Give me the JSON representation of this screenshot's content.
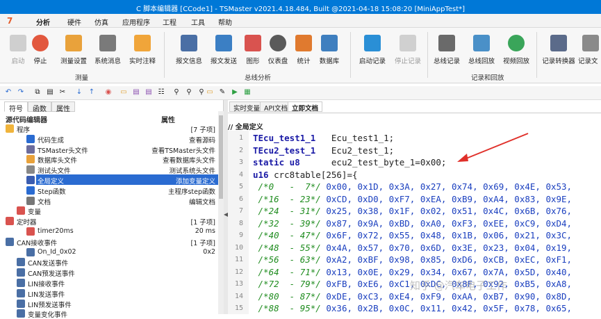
{
  "window": {
    "title": "C 脚本编辑器 [CCode1] - TSMaster v2021.4.18.484, Built @2021-04-18 15:08:20 [MiniAppTest*]"
  },
  "menu": [
    "分析",
    "硬件",
    "仿真",
    "应用程序",
    "工程",
    "工具",
    "帮助"
  ],
  "ribbon": {
    "buttons": [
      "启动",
      "停止",
      "测量设置",
      "系统消息",
      "实时注释",
      "报文信息",
      "报文发送",
      "图形",
      "仪表盘",
      "统计",
      "数据库",
      "启动记录",
      "停止记录",
      "总线记录",
      "总线回放",
      "视频回放",
      "记录转换器",
      "记录文"
    ],
    "groups": [
      "测量",
      "总线分析",
      "记录和回放"
    ],
    "colors": {
      "accent": "#0078d7",
      "start": "#8a8a8a",
      "stop": "#e2583e",
      "note": "#f0a53a",
      "play": "#2a8fd6"
    }
  },
  "left": {
    "tabs": [
      "符号",
      "函数",
      "属性"
    ],
    "headers": {
      "col1": "源代码编辑器",
      "col2": "属性"
    },
    "tree": [
      {
        "label": "程序",
        "right": "[7 子项]",
        "icon": "folder-icon"
      },
      {
        "label": "代码生成",
        "right": "查看源码",
        "icon": "c-code-icon"
      },
      {
        "label": "TSMaster头文件",
        "right": "查看TSMaster头文件",
        "icon": "header-icon"
      },
      {
        "label": "数据库头文件",
        "right": "查看数据库头文件",
        "icon": "database-icon"
      },
      {
        "label": "测试头文件",
        "right": "测试系统头文件",
        "icon": "test-icon"
      },
      {
        "label": "全局定义",
        "right": "添加变量定义",
        "icon": "global-icon"
      },
      {
        "label": "Step函数",
        "right": "主程序step函数",
        "icon": "step-icon"
      },
      {
        "label": "文档",
        "right": "编辑文档",
        "icon": "doc-icon"
      },
      {
        "label": "变量",
        "right": "",
        "icon": "variable-icon"
      },
      {
        "label": "定时器",
        "right": "[1 子项]",
        "icon": "timer-icon"
      },
      {
        "label": "timer20ms",
        "right": "20 ms",
        "icon": "clock-icon"
      },
      {
        "label": "CAN接收事件",
        "right": "[1 子项]",
        "icon": "can-rx-icon"
      },
      {
        "label": "On_Id_0x02",
        "right": "0x2",
        "icon": "event-icon"
      },
      {
        "label": "CAN发送事件",
        "right": "",
        "icon": "can-tx-icon"
      },
      {
        "label": "CAN预发送事件",
        "right": "",
        "icon": "can-pretx-icon"
      },
      {
        "label": "LIN接收事件",
        "right": "",
        "icon": "lin-rx-icon"
      },
      {
        "label": "LIN发送事件",
        "right": "",
        "icon": "lin-tx-icon"
      },
      {
        "label": "LIN预发送事件",
        "right": "",
        "icon": "lin-pretx-icon"
      },
      {
        "label": "变量变化事件",
        "right": "",
        "icon": "var-change-icon"
      }
    ]
  },
  "right": {
    "tabs": [
      "实时变量",
      "API文档",
      "立即文档"
    ],
    "section": "// 全局定义",
    "lines": [
      {
        "n": "1",
        "kw": "TEcu_test1_1",
        "rest": "   Ecu_test1_1;"
      },
      {
        "n": "2",
        "kw": "TEcu2_test_1",
        "rest": "   Ecu2_test_1;"
      },
      {
        "n": "3",
        "kw": "static u8",
        "rest": "      ecu2_test_byte_1=0x00;"
      },
      {
        "n": "4",
        "kw": "u16",
        "rest": " crc8table[256]={"
      },
      {
        "n": "5",
        "cm": " /*0   -  7*/",
        "vals": " 0x00, 0x1D, 0x3A, 0x27, 0x74, 0x69, 0x4E, 0x53,"
      },
      {
        "n": "6",
        "cm": " /*16  - 23*/",
        "vals": " 0xCD, 0xD0, 0xF7, 0xEA, 0xB9, 0xA4, 0x83, 0x9E,"
      },
      {
        "n": "7",
        "cm": " /*24  - 31*/",
        "vals": " 0x25, 0x38, 0x1F, 0x02, 0x51, 0x4C, 0x6B, 0x76,"
      },
      {
        "n": "8",
        "cm": " /*32  - 39*/",
        "vals": " 0x87, 0x9A, 0xBD, 0xA0, 0xF3, 0xEE, 0xC9, 0xD4,"
      },
      {
        "n": "9",
        "cm": " /*40  - 47*/",
        "vals": " 0x6F, 0x72, 0x55, 0x48, 0x1B, 0x06, 0x21, 0x3C,"
      },
      {
        "n": "10",
        "cm": " /*48  - 55*/",
        "vals": " 0x4A, 0x57, 0x70, 0x6D, 0x3E, 0x23, 0x04, 0x19,"
      },
      {
        "n": "11",
        "cm": " /*56  - 63*/",
        "vals": " 0xA2, 0xBF, 0x98, 0x85, 0xD6, 0xCB, 0xEC, 0xF1,"
      },
      {
        "n": "12",
        "cm": " /*64  - 71*/",
        "vals": " 0x13, 0x0E, 0x29, 0x34, 0x67, 0x7A, 0x5D, 0x40,"
      },
      {
        "n": "13",
        "cm": " /*72  - 79*/",
        "vals": " 0xFB, 0xE6, 0xC1, 0xDC, 0x8F, 0x92, 0xB5, 0xA8,"
      },
      {
        "n": "14",
        "cm": " /*80  - 87*/",
        "vals": " 0xDE, 0xC3, 0xE4, 0xF9, 0xAA, 0xB7, 0x90, 0x8D,"
      },
      {
        "n": "15",
        "cm": " /*88  - 95*/",
        "vals": " 0x36, 0x2B, 0x0C, 0x11, 0x42, 0x5F, 0x78, 0x65,"
      }
    ]
  },
  "watermark": "知乎 @汽车电子工作"
}
